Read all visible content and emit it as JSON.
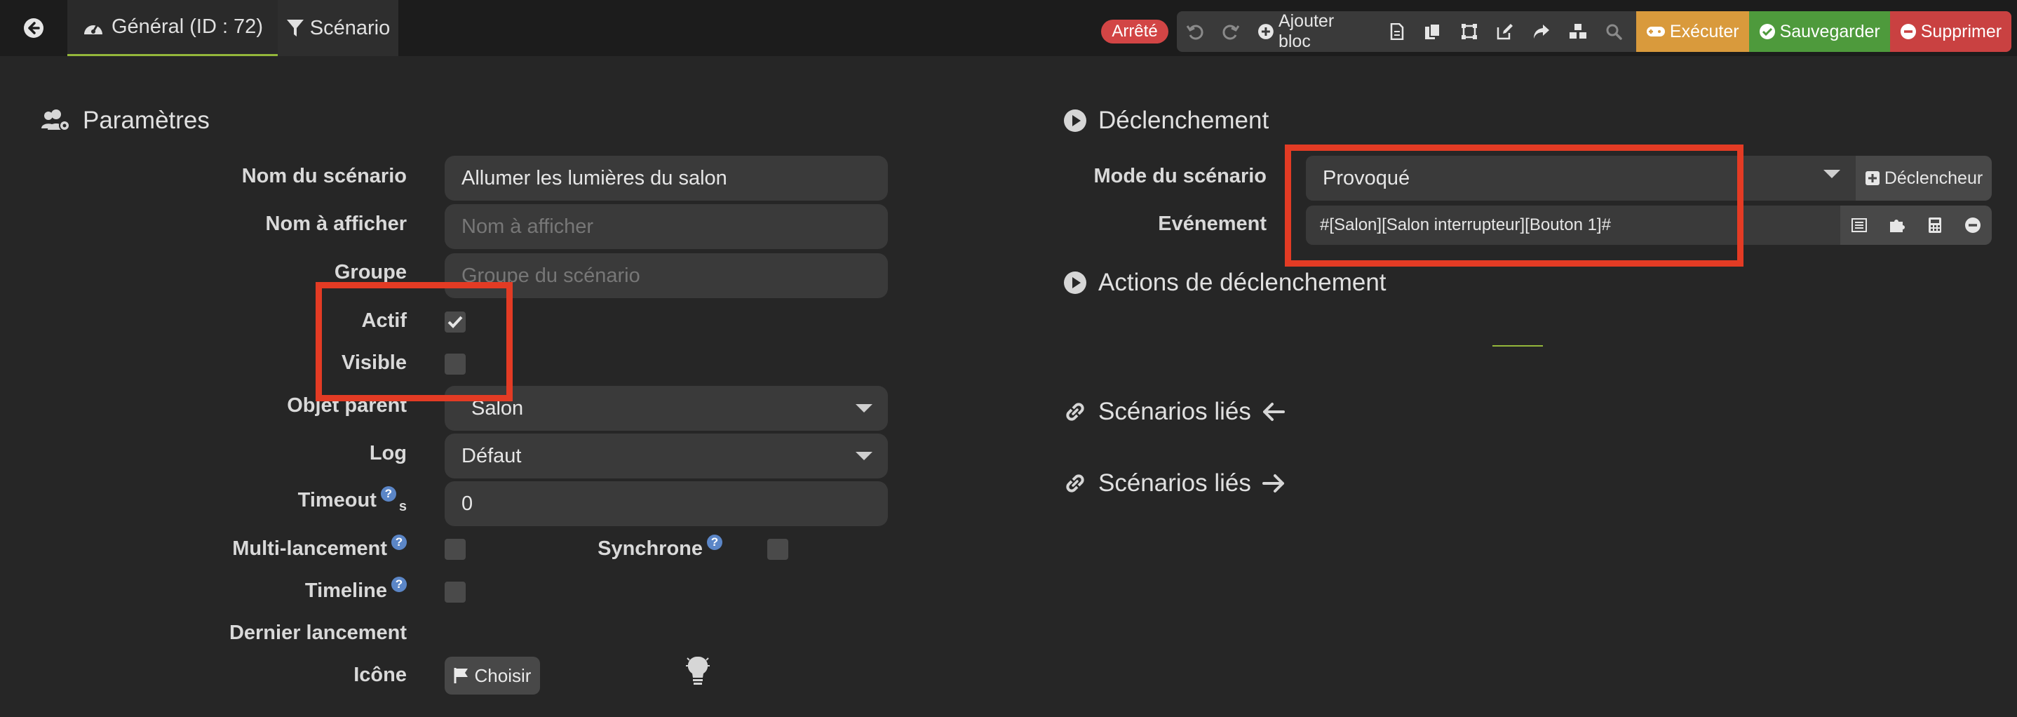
{
  "nav": {
    "general_tab": "Général (ID : 72)",
    "scenario_tab": "Scénario"
  },
  "status": {
    "label": "Arrêté",
    "color": "#d24545"
  },
  "toolbar": {
    "add_block": "Ajouter bloc",
    "run": "Exécuter",
    "save": "Sauvegarder",
    "delete": "Supprimer",
    "colors": {
      "run": "#d99a3c",
      "save": "#4e9a3c",
      "delete": "#c94141"
    }
  },
  "parametres": {
    "title": "Paramètres",
    "fields": {
      "nom_label": "Nom du scénario",
      "nom_value": "Allumer les lumières du salon",
      "afficher_label": "Nom à afficher",
      "afficher_placeholder": "Nom à afficher",
      "groupe_label": "Groupe",
      "groupe_placeholder": "Groupe du scénario",
      "actif_label": "Actif",
      "actif_checked": true,
      "visible_label": "Visible",
      "visible_checked": false,
      "objet_label": "Objet parent",
      "objet_value": "Salon",
      "log_label": "Log",
      "log_value": "Défaut",
      "timeout_label": "Timeout",
      "timeout_unit": "s",
      "timeout_value": "0",
      "multi_label": "Multi-lancement",
      "synchrone_label": "Synchrone",
      "timeline_label": "Timeline",
      "dernier_label": "Dernier lancement",
      "icone_label": "Icône",
      "choose_button": "Choisir"
    }
  },
  "declenchement": {
    "title": "Déclenchement",
    "mode_label": "Mode du scénario",
    "mode_value": "Provoqué",
    "trigger_button": "Déclencheur",
    "event_label": "Evénement",
    "event_value": "#[Salon][Salon interrupteur][Bouton 1]#",
    "actions_title": "Actions de déclenchement"
  },
  "linked": {
    "title_in": "Scénarios liés",
    "title_out": "Scénarios liés"
  },
  "theme": {
    "accent": "#94b73b",
    "highlight_red": "#e33b24",
    "background": "#262626"
  }
}
